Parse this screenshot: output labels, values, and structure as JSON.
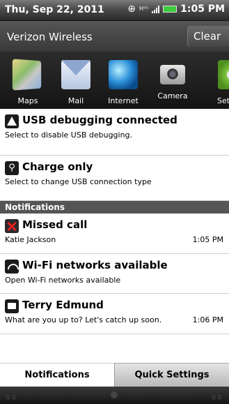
{
  "status_bar": {
    "date": "Thu, Sep 22, 2011",
    "network_type": "HSDPA",
    "time": "1:05 PM",
    "icons": [
      "gps-icon",
      "hsdpa-icon",
      "signal-icon",
      "battery-icon"
    ]
  },
  "carrier": {
    "name": "Verizon Wireless",
    "clear_label": "Clear"
  },
  "apps": [
    {
      "label": "Maps",
      "icon": "maps-icon"
    },
    {
      "label": "Mail",
      "icon": "mail-icon"
    },
    {
      "label": "Internet",
      "icon": "internet-icon"
    },
    {
      "label": "Camera",
      "icon": "camera-icon"
    },
    {
      "label": "Setti",
      "icon": "settings-icon"
    }
  ],
  "ongoing": [
    {
      "title": "USB debugging connected",
      "subtitle": "Select to disable USB debugging.",
      "icon": "usb-debugging-icon"
    },
    {
      "title": "Charge only",
      "subtitle": "Select to change USB connection type",
      "icon": "usb-icon"
    }
  ],
  "notifications_header": "Notifications",
  "notifications": [
    {
      "title": "Missed call",
      "subtitle": "Katie Jackson",
      "time": "1:05 PM",
      "icon": "missed-call-icon"
    },
    {
      "title": "Wi-Fi networks available",
      "subtitle": "Open Wi-Fi networks available",
      "time": "",
      "icon": "wifi-icon"
    },
    {
      "title": "Terry Edmund",
      "subtitle": "What are you up to? Let's catch up soon.",
      "time": "1:06 PM",
      "icon": "message-icon"
    }
  ],
  "tabs": [
    {
      "label": "Notifications",
      "active": true
    },
    {
      "label": "Quick Settings",
      "active": false
    }
  ]
}
